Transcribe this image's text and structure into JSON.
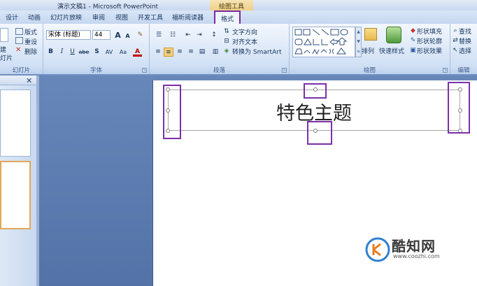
{
  "window": {
    "title": "演示文稿1 - Microsoft PowerPoint",
    "context_tab": "绘图工具"
  },
  "tabs": [
    "设计",
    "动画",
    "幻灯片放映",
    "审阅",
    "视图",
    "开发工具",
    "福昕阅读器",
    "格式"
  ],
  "active_tab": "格式",
  "ribbon": {
    "slides": {
      "new_label": "建",
      "new_label2": "灯片",
      "layout": "版式",
      "reset": "重设",
      "delete": "删除",
      "group": "幻灯片"
    },
    "font": {
      "name": "宋体 (标题)",
      "size": "44",
      "group": "字体",
      "bold": "B",
      "italic": "I",
      "underline": "U",
      "strike": "abe",
      "shadow": "S",
      "spacing": "AV",
      "case": "Aa",
      "color": "A",
      "grow": "A",
      "shrink": "A"
    },
    "paragraph": {
      "text_direction": "文字方向",
      "align_text": "对齐文本",
      "smartart": "转换为 SmartArt",
      "group": "段落"
    },
    "drawing": {
      "arrange": "排列",
      "quick_styles": "快速样式",
      "shape_fill": "形状填充",
      "shape_outline": "形状轮廓",
      "shape_effects": "形状效果",
      "group": "绘图"
    },
    "editing": {
      "find": "查找",
      "replace": "替换",
      "select": "选择",
      "group": "编辑"
    }
  },
  "slide": {
    "title": "特色主题"
  },
  "watermark": {
    "brand": "酷知网",
    "url": "www.coozhi.com"
  },
  "colors": {
    "highlight": "#7b2fa8",
    "ribbon_bg": "#dce8f8",
    "work_bg": "#5f80b5"
  }
}
